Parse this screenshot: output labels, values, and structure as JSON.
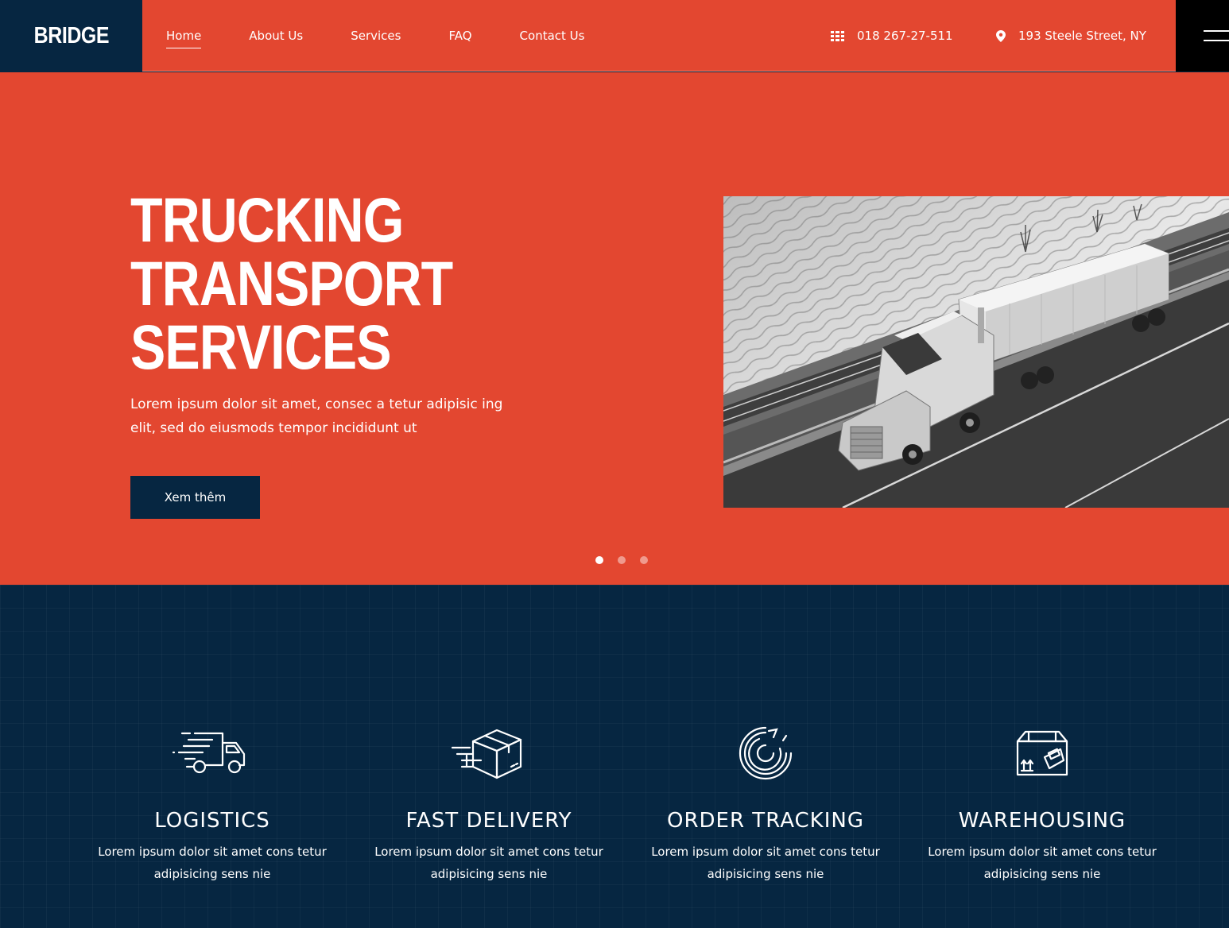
{
  "brand": {
    "logo": "BRIDGE"
  },
  "nav": {
    "items": [
      {
        "label": "Home",
        "active": true
      },
      {
        "label": "About Us",
        "active": false
      },
      {
        "label": "Services",
        "active": false
      },
      {
        "label": "FAQ",
        "active": false
      },
      {
        "label": "Contact Us",
        "active": false
      }
    ]
  },
  "contact": {
    "phone": "018 267-27-511",
    "phone_icon": "grid-phone-icon",
    "address": "193 Steele Street, NY",
    "address_icon": "map-pin-icon"
  },
  "hero": {
    "title_lines": [
      "TRUCKING",
      "TRANSPORT",
      "SERVICES"
    ],
    "description": "Lorem ipsum dolor sit amet, consec a tetur adipisic ing elit, sed do eiusmods tempor incididunt ut",
    "button_label": "Xem thêm",
    "slides": 3,
    "active_slide": 1
  },
  "features": [
    {
      "title": "LOGISTICS",
      "description": "Lorem ipsum dolor sit amet cons tetur adipisicing sens nie",
      "icon": "delivery-truck-icon"
    },
    {
      "title": "FAST DELIVERY",
      "description": "Lorem ipsum dolor sit amet cons tetur adipisicing sens nie",
      "icon": "package-box-icon"
    },
    {
      "title": "ORDER TRACKING",
      "description": "Lorem ipsum dolor sit amet cons tetur adipisicing sens nie",
      "icon": "tracking-cycle-icon"
    },
    {
      "title": "WAREHOUSING",
      "description": "Lorem ipsum dolor sit amet cons tetur adipisicing sens nie",
      "icon": "warehouse-box-icon"
    }
  ],
  "colors": {
    "primary_red": "#e34730",
    "navy": "#062641",
    "black": "#000000",
    "white": "#ffffff"
  }
}
